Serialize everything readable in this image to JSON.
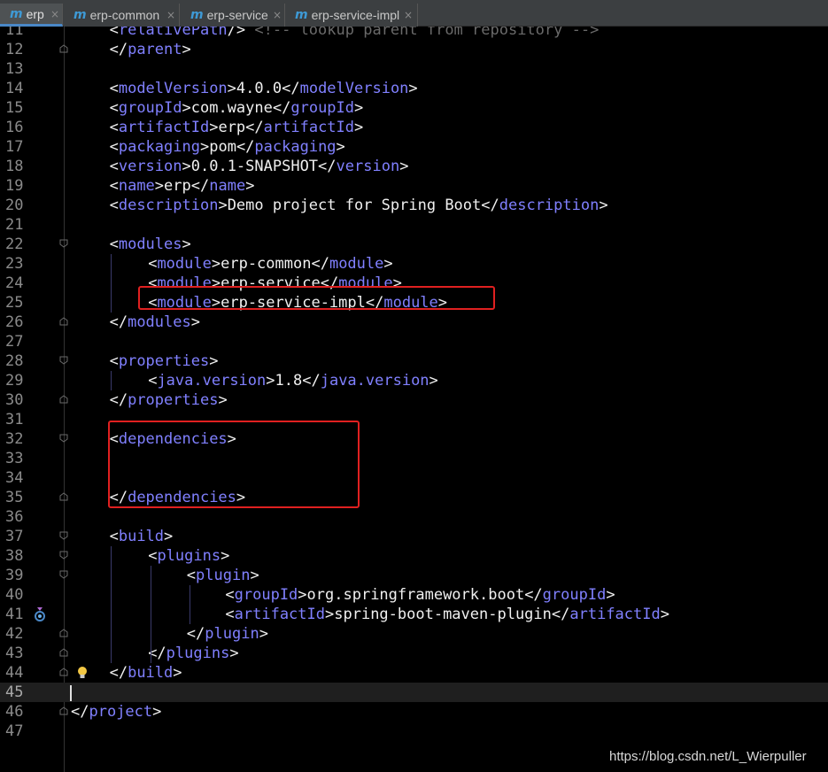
{
  "tabs": [
    {
      "label": "erp",
      "active": true
    },
    {
      "label": "erp-common",
      "active": false
    },
    {
      "label": "erp-service",
      "active": false
    },
    {
      "label": "erp-service-impl",
      "active": false
    }
  ],
  "tab_icon_glyph": "m",
  "close_glyph": "×",
  "lines": [
    {
      "n": "11",
      "tokens": [
        [
          "br",
          "<"
        ],
        [
          "tag",
          "relativePath"
        ],
        [
          "br",
          "/> "
        ],
        [
          "cm",
          "<!-- lookup parent from repository -->"
        ]
      ]
    },
    {
      "n": "12",
      "tokens": [
        [
          "br",
          "</"
        ],
        [
          "tag",
          "parent"
        ],
        [
          "br",
          ">"
        ]
      ]
    },
    {
      "n": "13",
      "tokens": []
    },
    {
      "n": "14",
      "tokens": [
        [
          "br",
          "<"
        ],
        [
          "tag",
          "modelVersion"
        ],
        [
          "br",
          ">"
        ],
        [
          "txt",
          "4.0.0"
        ],
        [
          "br",
          "</"
        ],
        [
          "tag",
          "modelVersion"
        ],
        [
          "br",
          ">"
        ]
      ]
    },
    {
      "n": "15",
      "tokens": [
        [
          "br",
          "<"
        ],
        [
          "tag",
          "groupId"
        ],
        [
          "br",
          ">"
        ],
        [
          "txt",
          "com.wayne"
        ],
        [
          "br",
          "</"
        ],
        [
          "tag",
          "groupId"
        ],
        [
          "br",
          ">"
        ]
      ]
    },
    {
      "n": "16",
      "tokens": [
        [
          "br",
          "<"
        ],
        [
          "tag",
          "artifactId"
        ],
        [
          "br",
          ">"
        ],
        [
          "txt",
          "erp"
        ],
        [
          "br",
          "</"
        ],
        [
          "tag",
          "artifactId"
        ],
        [
          "br",
          ">"
        ]
      ]
    },
    {
      "n": "17",
      "tokens": [
        [
          "br",
          "<"
        ],
        [
          "tag",
          "packaging"
        ],
        [
          "br",
          ">"
        ],
        [
          "txt",
          "pom"
        ],
        [
          "br",
          "</"
        ],
        [
          "tag",
          "packaging"
        ],
        [
          "br",
          ">"
        ]
      ]
    },
    {
      "n": "18",
      "tokens": [
        [
          "br",
          "<"
        ],
        [
          "tag",
          "version"
        ],
        [
          "br",
          ">"
        ],
        [
          "txt",
          "0.0.1-SNAPSHOT"
        ],
        [
          "br",
          "</"
        ],
        [
          "tag",
          "version"
        ],
        [
          "br",
          ">"
        ]
      ]
    },
    {
      "n": "19",
      "tokens": [
        [
          "br",
          "<"
        ],
        [
          "tag",
          "name"
        ],
        [
          "br",
          ">"
        ],
        [
          "txt",
          "erp"
        ],
        [
          "br",
          "</"
        ],
        [
          "tag",
          "name"
        ],
        [
          "br",
          ">"
        ]
      ]
    },
    {
      "n": "20",
      "tokens": [
        [
          "br",
          "<"
        ],
        [
          "tag",
          "description"
        ],
        [
          "br",
          ">"
        ],
        [
          "txt",
          "Demo project for Spring Boot"
        ],
        [
          "br",
          "</"
        ],
        [
          "tag",
          "description"
        ],
        [
          "br",
          ">"
        ]
      ]
    },
    {
      "n": "21",
      "tokens": []
    },
    {
      "n": "22",
      "tokens": [
        [
          "br",
          "<"
        ],
        [
          "tag",
          "modules"
        ],
        [
          "br",
          ">"
        ]
      ]
    },
    {
      "n": "23",
      "tokens": [
        [
          "br",
          "<"
        ],
        [
          "tag",
          "module"
        ],
        [
          "br",
          ">"
        ],
        [
          "txt",
          "erp-common"
        ],
        [
          "br",
          "</"
        ],
        [
          "tag",
          "module"
        ],
        [
          "br",
          ">"
        ]
      ]
    },
    {
      "n": "24",
      "tokens": [
        [
          "br",
          "<"
        ],
        [
          "tag",
          "module"
        ],
        [
          "br",
          ">"
        ],
        [
          "txt",
          "erp-service"
        ],
        [
          "br",
          "</"
        ],
        [
          "tag",
          "module"
        ],
        [
          "br",
          ">"
        ]
      ]
    },
    {
      "n": "25",
      "tokens": [
        [
          "br",
          "<"
        ],
        [
          "tag",
          "module"
        ],
        [
          "br",
          ">"
        ],
        [
          "txt",
          "erp-service-impl"
        ],
        [
          "br",
          "</"
        ],
        [
          "tag",
          "module"
        ],
        [
          "br",
          ">"
        ]
      ]
    },
    {
      "n": "26",
      "tokens": [
        [
          "br",
          "</"
        ],
        [
          "tag",
          "modules"
        ],
        [
          "br",
          ">"
        ]
      ]
    },
    {
      "n": "27",
      "tokens": []
    },
    {
      "n": "28",
      "tokens": [
        [
          "br",
          "<"
        ],
        [
          "tag",
          "properties"
        ],
        [
          "br",
          ">"
        ]
      ]
    },
    {
      "n": "29",
      "tokens": [
        [
          "br",
          "<"
        ],
        [
          "tag",
          "java.version"
        ],
        [
          "br",
          ">"
        ],
        [
          "txt",
          "1.8"
        ],
        [
          "br",
          "</"
        ],
        [
          "tag",
          "java.version"
        ],
        [
          "br",
          ">"
        ]
      ]
    },
    {
      "n": "30",
      "tokens": [
        [
          "br",
          "</"
        ],
        [
          "tag",
          "properties"
        ],
        [
          "br",
          ">"
        ]
      ]
    },
    {
      "n": "31",
      "tokens": []
    },
    {
      "n": "32",
      "tokens": [
        [
          "br",
          "<"
        ],
        [
          "tag",
          "dependencies"
        ],
        [
          "br",
          ">"
        ]
      ]
    },
    {
      "n": "33",
      "tokens": []
    },
    {
      "n": "34",
      "tokens": []
    },
    {
      "n": "35",
      "tokens": [
        [
          "br",
          "</"
        ],
        [
          "tag",
          "dependencies"
        ],
        [
          "br",
          ">"
        ]
      ]
    },
    {
      "n": "36",
      "tokens": []
    },
    {
      "n": "37",
      "tokens": [
        [
          "br",
          "<"
        ],
        [
          "tag",
          "build"
        ],
        [
          "br",
          ">"
        ]
      ]
    },
    {
      "n": "38",
      "tokens": [
        [
          "br",
          "<"
        ],
        [
          "tag",
          "plugins"
        ],
        [
          "br",
          ">"
        ]
      ]
    },
    {
      "n": "39",
      "tokens": [
        [
          "br",
          "<"
        ],
        [
          "tag",
          "plugin"
        ],
        [
          "br",
          ">"
        ]
      ]
    },
    {
      "n": "40",
      "tokens": [
        [
          "br",
          "<"
        ],
        [
          "tag",
          "groupId"
        ],
        [
          "br",
          ">"
        ],
        [
          "txt",
          "org.springframework.boot"
        ],
        [
          "br",
          "</"
        ],
        [
          "tag",
          "groupId"
        ],
        [
          "br",
          ">"
        ]
      ]
    },
    {
      "n": "41",
      "tokens": [
        [
          "br",
          "<"
        ],
        [
          "tag",
          "artifactId"
        ],
        [
          "br",
          ">"
        ],
        [
          "txt",
          "spring-boot-maven-plugin"
        ],
        [
          "br",
          "</"
        ],
        [
          "tag",
          "artifactId"
        ],
        [
          "br",
          ">"
        ]
      ]
    },
    {
      "n": "42",
      "tokens": [
        [
          "br",
          "</"
        ],
        [
          "tag",
          "plugin"
        ],
        [
          "br",
          ">"
        ]
      ]
    },
    {
      "n": "43",
      "tokens": [
        [
          "br",
          "</"
        ],
        [
          "tag",
          "plugins"
        ],
        [
          "br",
          ">"
        ]
      ]
    },
    {
      "n": "44",
      "tokens": [
        [
          "br",
          "</"
        ],
        [
          "tag",
          "build"
        ],
        [
          "br",
          ">"
        ]
      ]
    },
    {
      "n": "45",
      "tokens": []
    },
    {
      "n": "46",
      "tokens": [
        [
          "br",
          "</"
        ],
        [
          "tag",
          "project"
        ],
        [
          "br",
          ">"
        ]
      ]
    },
    {
      "n": "47",
      "tokens": []
    }
  ],
  "watermark": "https://blog.csdn.net/L_Wierpuller",
  "colors": {
    "background": "#000000",
    "tag": "#8080ff",
    "text": "#f0f0f0",
    "line_number": "#8a8a8a",
    "highlight_box": "#e02020",
    "tab_accent": "#4a88c7"
  }
}
